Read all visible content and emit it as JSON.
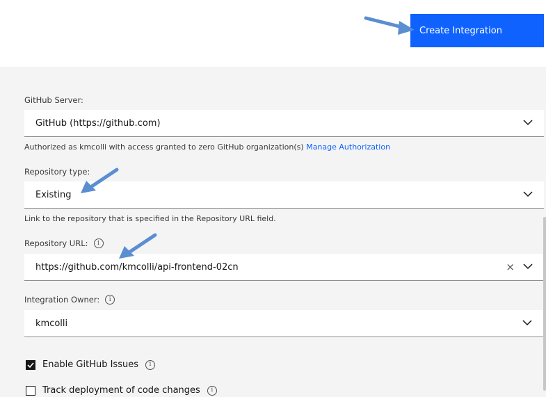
{
  "header": {
    "create_button_label": "Create Integration"
  },
  "github_server": {
    "label": "GitHub Server:",
    "value": "GitHub (https://github.com)",
    "helper_text": "Authorized as kmcolli with access granted to zero GitHub organization(s)",
    "helper_link": "Manage Authorization"
  },
  "repository_type": {
    "label": "Repository type:",
    "value": "Existing",
    "helper_text": "Link to the repository that is specified in the Repository URL field."
  },
  "repository_url": {
    "label": "Repository URL:",
    "value": "https://github.com/kmcolli/api-frontend-02cn"
  },
  "integration_owner": {
    "label": "Integration Owner:",
    "value": "kmcolli"
  },
  "options": {
    "enable_issues": {
      "label": "Enable GitHub Issues",
      "checked": true
    },
    "track_deployment": {
      "label": "Track deployment of code changes",
      "checked": false
    }
  },
  "colors": {
    "primary": "#0f62fe",
    "annotation_arrow": "#5b8ed1"
  },
  "icons": {
    "info": "info-icon",
    "chevron": "chevron-down-icon",
    "clear": "close-icon",
    "check": "checkmark-icon",
    "annotation": "arrow-annotation-icon"
  }
}
